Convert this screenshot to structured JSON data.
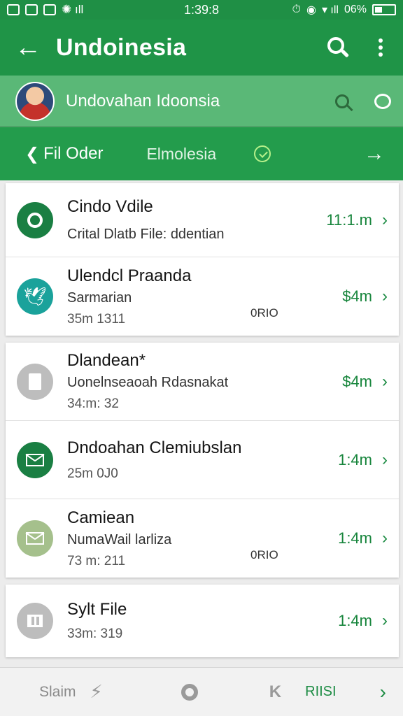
{
  "status_bar": {
    "time": "1:39:8",
    "battery": "06%"
  },
  "app_bar": {
    "back_icon": "arrow-left-icon",
    "title": "Undoinesia"
  },
  "account": {
    "name": "Undovahan Idoonsia"
  },
  "tabs": {
    "back_label": "Fil Oder",
    "middle_label": "Elmolesia"
  },
  "list": [
    {
      "title": "Cindo Vdile",
      "subtitle": "Crital Dlatb File: ddentian",
      "amount": "11:1.m",
      "icon_color": "#1a7f43",
      "icon": "chat-ring-icon"
    },
    {
      "title": "Ulendcl Praanda",
      "subtitle": "Sarmarian",
      "meta": "35m 1311",
      "tag": "0RIO",
      "amount": "$4m",
      "icon_color": "#1aa29b",
      "icon": "bird-icon"
    },
    {
      "title": "Dlandean*",
      "subtitle": "Uonelnseaoah Rdasnakat",
      "meta": "34:m: 32",
      "amount": "$4m",
      "icon_color": "#bdbdbd",
      "icon": "document-icon"
    },
    {
      "title": "Dndoahan Clemiubslan",
      "meta": "25m 0J0",
      "amount": "1:4m",
      "icon_color": "#1a7f43",
      "icon": "envelope-icon"
    },
    {
      "title": "Camiean",
      "subtitle": "NumaWail larliza",
      "meta": "73 m: 211",
      "tag": "0RIO",
      "amount": "1:4m",
      "icon_color": "#a5c08c",
      "icon": "envelope-icon"
    },
    {
      "title": "Sylt File",
      "meta": "33m: 319",
      "amount": "1:4m",
      "icon_color": "#bdbdbd",
      "icon": "file-bars-icon"
    }
  ],
  "bottom_bar": {
    "label": "Slaim",
    "action": "RIISI"
  }
}
